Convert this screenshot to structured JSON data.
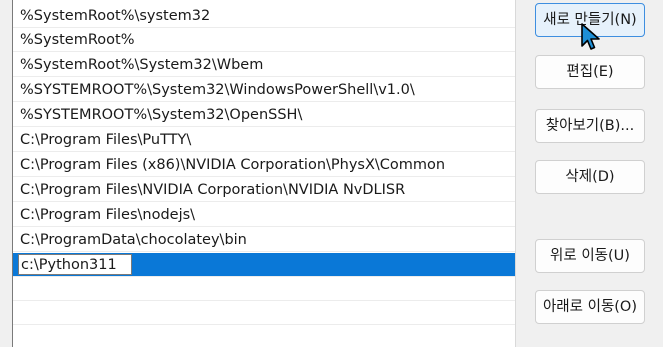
{
  "paths": [
    "%SystemRoot%\\system32",
    "%SystemRoot%",
    "%SystemRoot%\\System32\\Wbem",
    "%SYSTEMROOT%\\System32\\WindowsPowerShell\\v1.0\\",
    "%SYSTEMROOT%\\System32\\OpenSSH\\",
    "C:\\Program Files\\PuTTY\\",
    "C:\\Program Files (x86)\\NVIDIA Corporation\\PhysX\\Common",
    "C:\\Program Files\\NVIDIA Corporation\\NVIDIA NvDLISR",
    "C:\\Program Files\\nodejs\\",
    "C:\\ProgramData\\chocolatey\\bin"
  ],
  "editing_value": "c:\\Python311",
  "buttons": {
    "new": "새로 만들기(N)",
    "edit": "편집(E)",
    "browse": "찾아보기(B)...",
    "delete": "삭제(D)",
    "move_up": "위로 이동(U)",
    "move_down": "아래로 이동(O)"
  },
  "colors": {
    "selection": "#0a78d7",
    "primary_button_border": "#3d8ee0",
    "cursor_fill": "#1e8fd6"
  },
  "icons": {
    "cursor": "mouse-pointer-icon"
  }
}
